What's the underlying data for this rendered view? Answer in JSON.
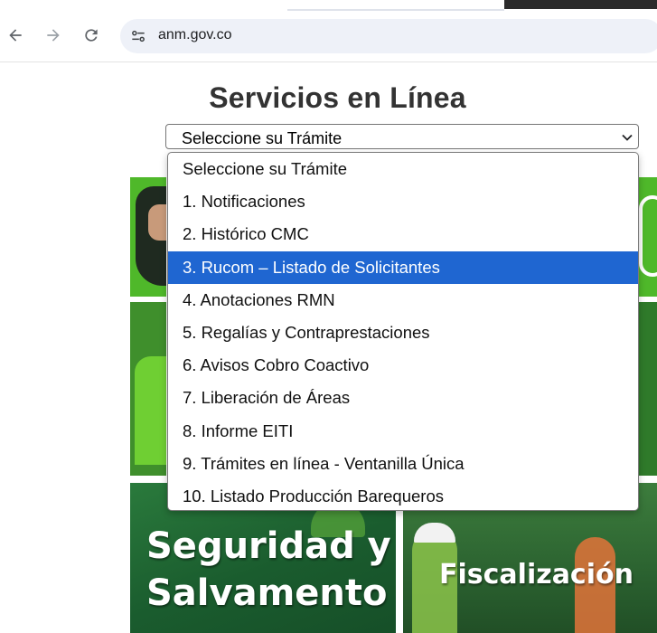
{
  "browser": {
    "url": "anm.gov.co"
  },
  "page": {
    "title": "Servicios en Línea",
    "select": {
      "value": "Seleccione su Trámite",
      "highlighted_index": 3,
      "options": [
        "Seleccione su Trámite",
        "1. Notificaciones",
        "2. Histórico CMC",
        "3. Rucom – Listado de Solicitantes",
        "4. Anotaciones RMN",
        "5. Regalías y Contraprestaciones",
        "6. Avisos Cobro Coactivo",
        "7. Liberación de Áreas",
        "8. Informe EITI",
        "9. Trámites en línea - Ventanilla Única",
        "10. Listado Producción Barequeros"
      ]
    },
    "tiles": {
      "seguridad": {
        "line1": "Seguridad y",
        "line2": "Salvamento"
      },
      "fiscalizacion": {
        "label": "Fiscalización"
      }
    }
  },
  "colors": {
    "highlight": "#1f66d1",
    "brand_green": "#4fb82a"
  },
  "icons": {
    "back": "arrow-left-icon",
    "forward": "arrow-right-icon",
    "reload": "reload-icon",
    "site_info": "tune-icon",
    "select_arrow": "chevron-down-icon"
  }
}
